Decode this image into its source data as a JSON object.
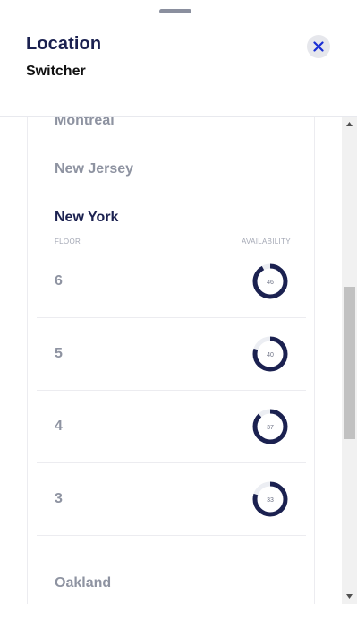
{
  "header": {
    "title": "Location",
    "subtitle": "Switcher"
  },
  "locations": [
    {
      "name": "Montreal",
      "active": false
    },
    {
      "name": "New Jersey",
      "active": false
    },
    {
      "name": "New York",
      "active": true
    },
    {
      "name": "Oakland",
      "active": false
    }
  ],
  "table": {
    "floor_header": "FLOOR",
    "availability_header": "AVAILABILITY",
    "rows": [
      {
        "floor": "6",
        "availability": "46",
        "fill": 0.92
      },
      {
        "floor": "5",
        "availability": "40",
        "fill": 0.8
      },
      {
        "floor": "4",
        "availability": "37",
        "fill": 0.88
      },
      {
        "floor": "3",
        "availability": "33",
        "fill": 0.8
      }
    ]
  },
  "colors": {
    "navy": "#1b2150",
    "muted": "#8e93a1",
    "donut_track": "#eceef3",
    "close_icon": "#1a2fd4"
  },
  "icons": {
    "close": "close-icon",
    "scroll_up": "scroll-up-arrow-icon",
    "scroll_down": "scroll-down-arrow-icon"
  }
}
